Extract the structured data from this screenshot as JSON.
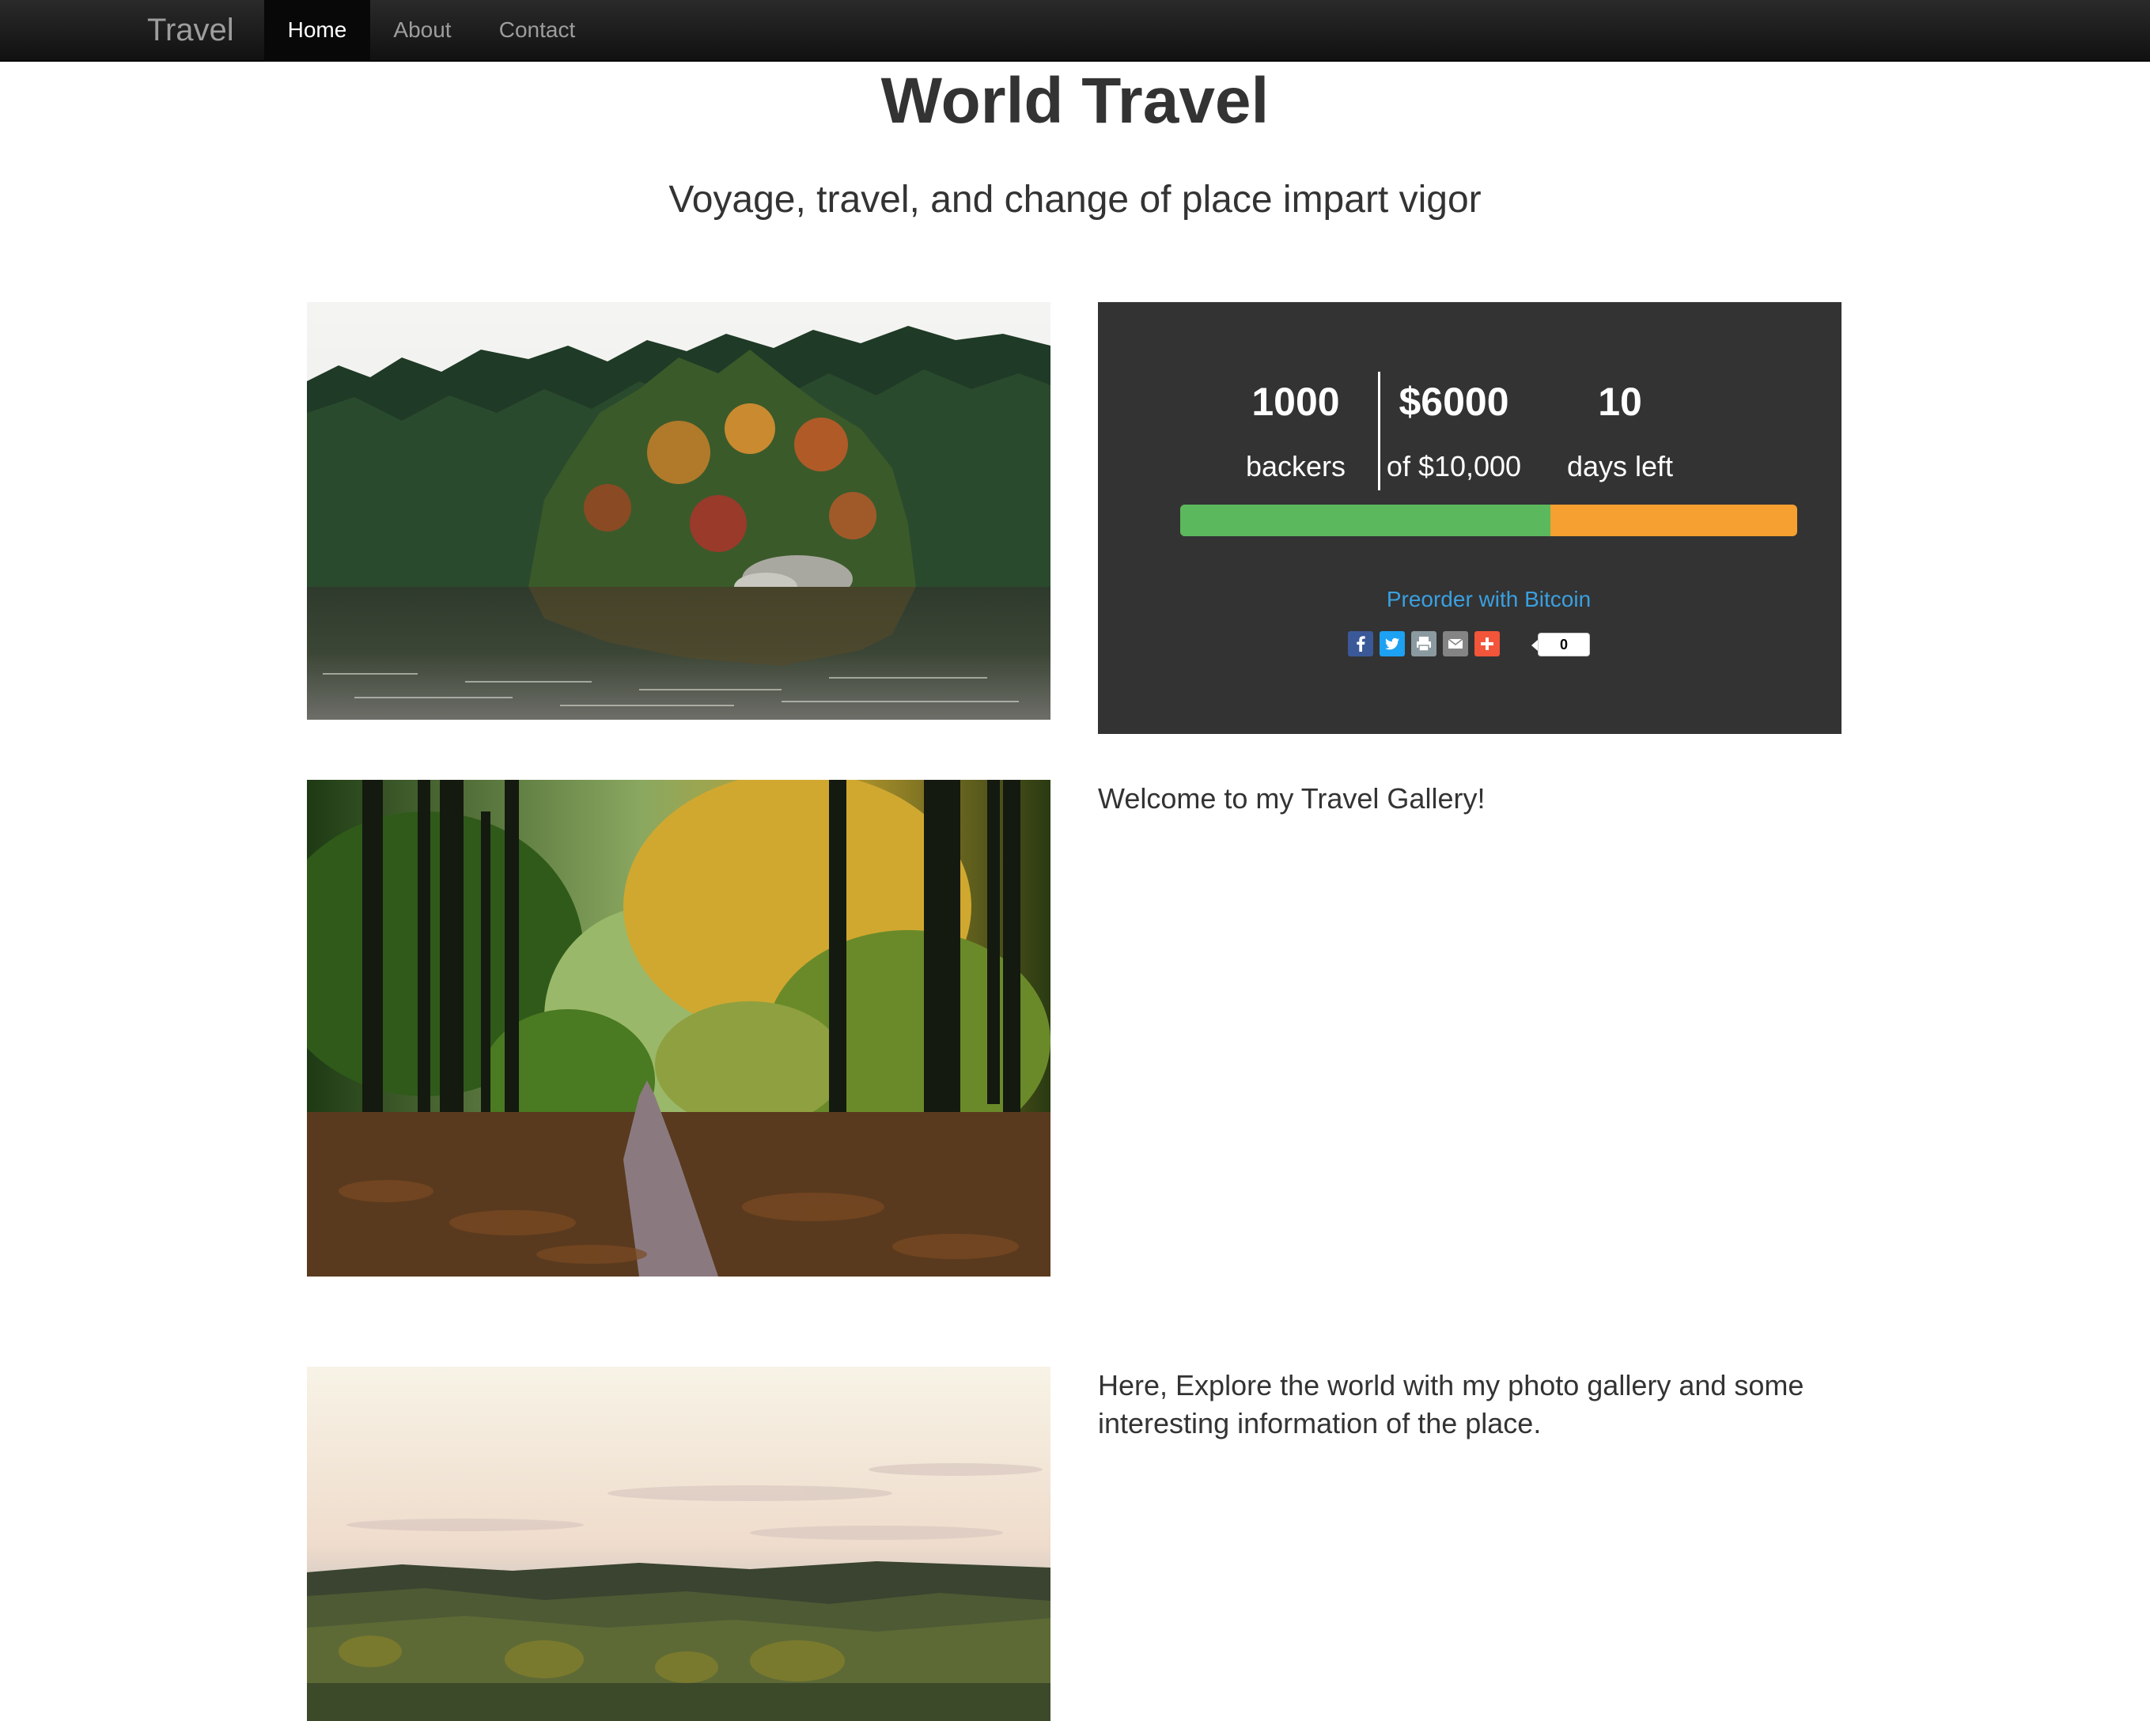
{
  "navbar": {
    "brand": "Travel",
    "items": [
      {
        "label": "Home",
        "active": true
      },
      {
        "label": "About",
        "active": false
      },
      {
        "label": "Contact",
        "active": false
      }
    ]
  },
  "header": {
    "title": "World Travel",
    "subtitle": "Voyage, travel, and change of place impart vigor"
  },
  "campaign": {
    "backers_value": "1000",
    "backers_label": "backers",
    "raised_value": "$6000",
    "raised_label": "of $10,000",
    "days_value": "10",
    "days_label": "days left",
    "progress_fraction": 0.6,
    "progress_colors": {
      "filled": "#5cb85c",
      "remaining": "#f5a030"
    },
    "preorder_link": "Preorder with Bitcoin",
    "share_icons": [
      "facebook-icon",
      "twitter-icon",
      "print-icon",
      "email-icon",
      "add-more-icon"
    ],
    "share_count": "0"
  },
  "gallery": {
    "welcome_text": "Welcome to my Travel Gallery!",
    "explore_text": "Here, Explore the world with my photo gallery and some interesting information of the place."
  },
  "colors": {
    "panel_bg": "#333333",
    "link": "#3aa0e0",
    "navbar_bg": "#1a1a1a"
  }
}
